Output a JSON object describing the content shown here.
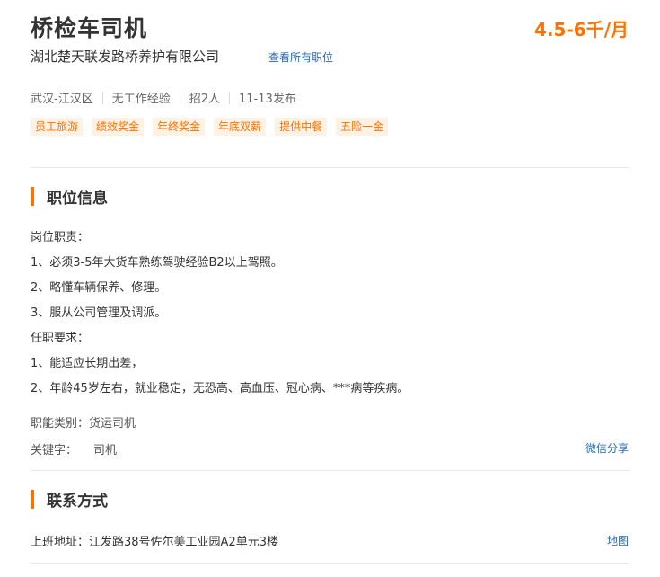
{
  "job": {
    "title": "桥检车司机",
    "salary": "4.5-6千/月",
    "company": "湖北楚天联发路桥养护有限公司",
    "view_all_label": "查看所有职位",
    "meta": [
      "武汉-江汉区",
      "无工作经验",
      "招2人",
      "11-13发布"
    ],
    "tags": [
      "员工旅游",
      "绩效奖金",
      "年终奖金",
      "年底双薪",
      "提供中餐",
      "五险一金"
    ]
  },
  "position_info": {
    "section_title": "职位信息",
    "lines": [
      "岗位职责：",
      "1、必须3-5年大货车熟练驾驶经验B2以上驾照。",
      "2、略懂车辆保养、修理。",
      "3、服从公司管理及调派。",
      "任职要求：",
      "1、能适应长期出差，",
      "2、年龄45岁左右，就业稳定，无恐高、高血压、冠心病、***病等疾病。"
    ],
    "category_label": "职能类别：",
    "category_value": "货运司机",
    "keyword_label": "关键字：",
    "keyword_value": "司机",
    "share_label": "微信分享"
  },
  "contact": {
    "section_title": "联系方式",
    "address_label": "上班地址：",
    "address_value": "江发路38号佐尔美工业园A2单元3楼",
    "map_label": "地图"
  },
  "colors": {
    "accent": "#ff7200",
    "link": "#2a6ab1",
    "tag_bg": "#fef2e5"
  }
}
